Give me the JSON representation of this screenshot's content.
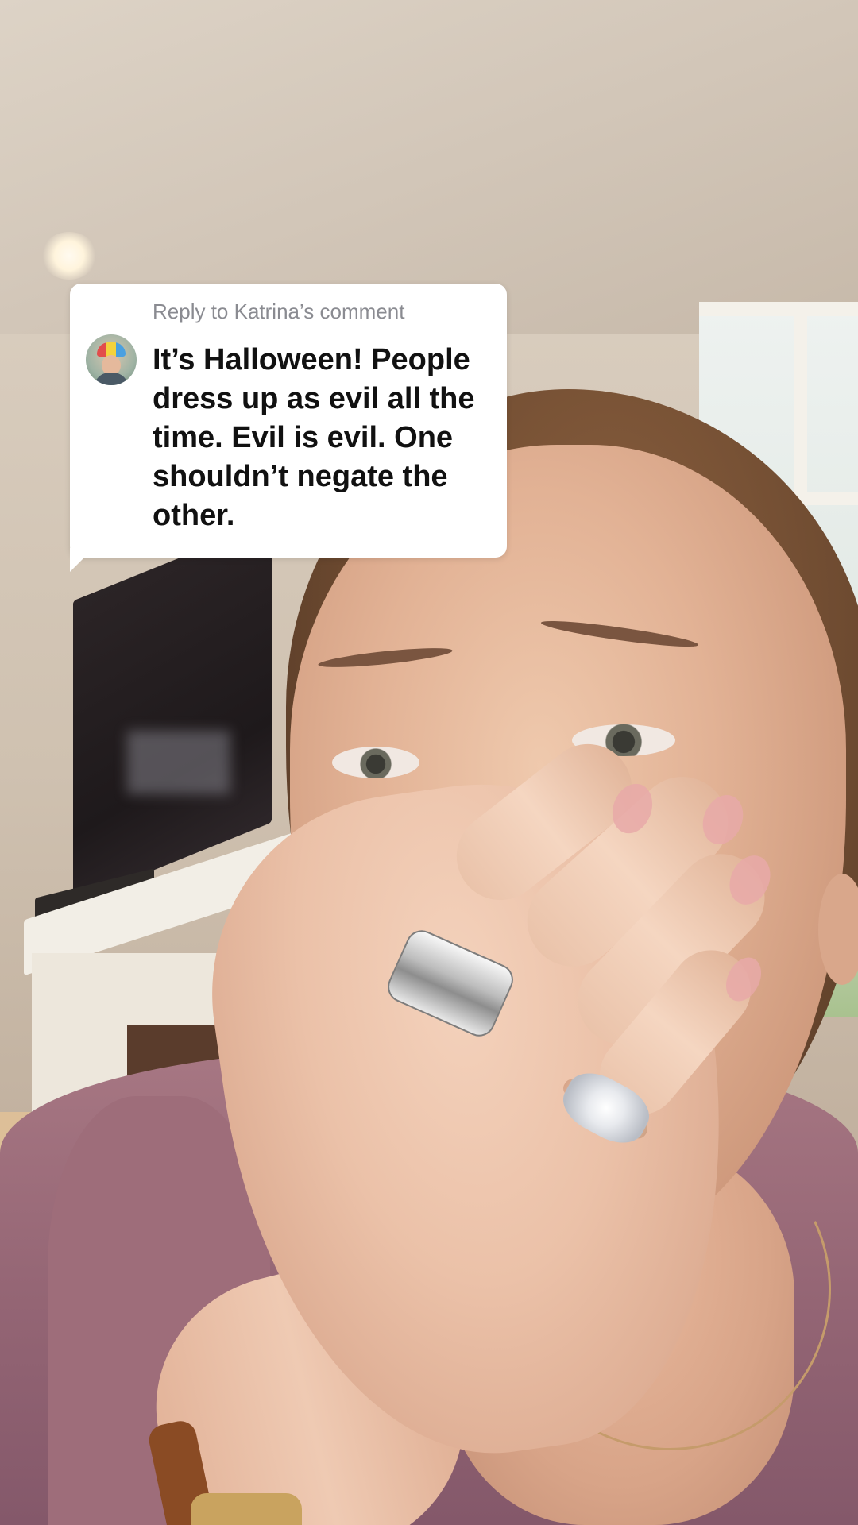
{
  "reply_card": {
    "header": "Reply to Katrina’s comment",
    "comment": "It’s Halloween! People dress up as evil all the time. Evil is evil. One shouldn’t negate the other.",
    "avatar_icon": "commenter-avatar"
  },
  "colors": {
    "card_background": "#ffffff",
    "header_text": "#8a8b91",
    "comment_text": "#111111"
  }
}
